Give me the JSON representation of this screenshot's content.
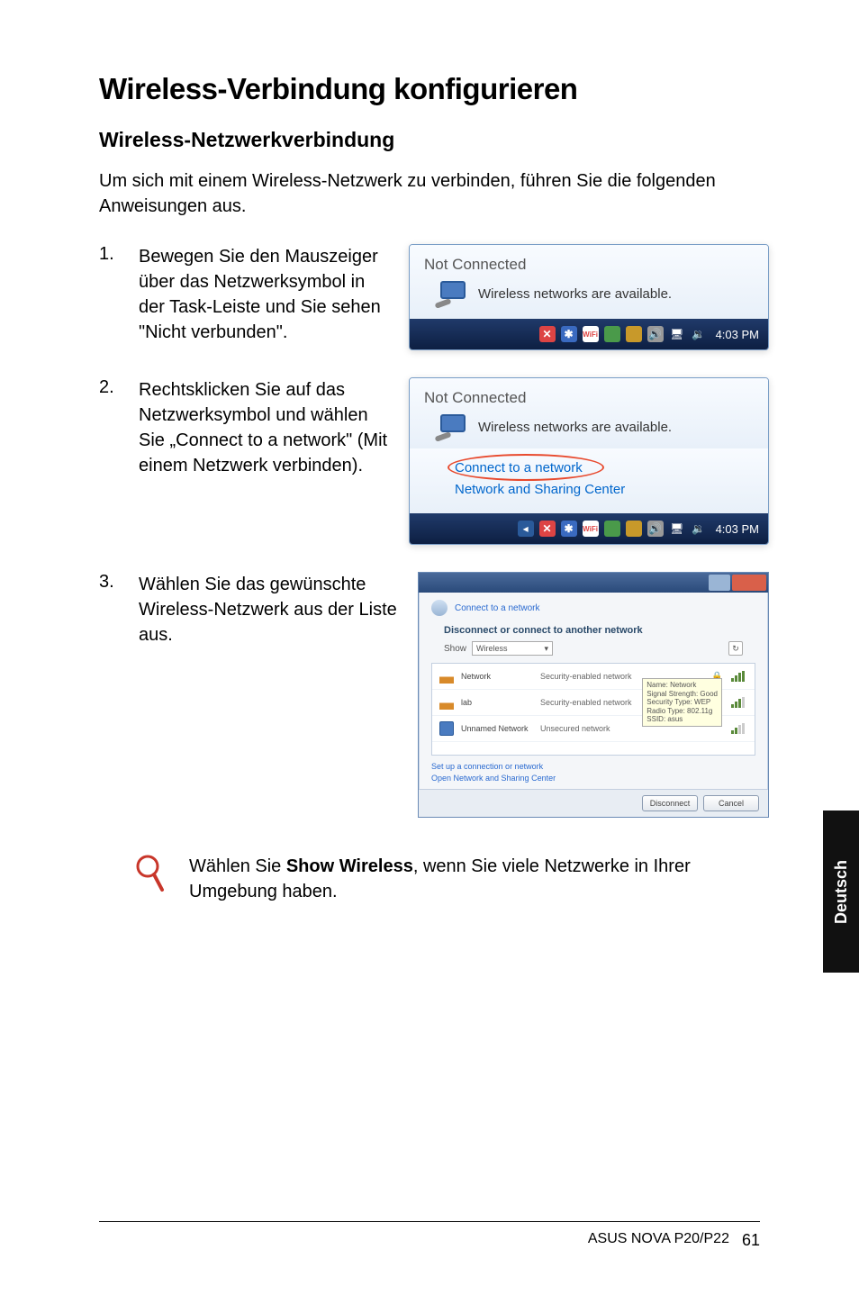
{
  "headings": {
    "h1": "Wireless-Verbindung konfigurieren",
    "h2": "Wireless-Netzwerkverbindung"
  },
  "intro": "Um sich mit einem Wireless-Netzwerk zu verbinden, führen Sie die folgenden Anweisungen aus.",
  "steps": [
    {
      "num": "1.",
      "text": "Bewegen Sie den Mauszeiger über das Netzwerksymbol in der Task-Leiste und Sie sehen \"Nicht verbunden\"."
    },
    {
      "num": "2.",
      "text": "Rechtsklicken Sie auf das Netzwerksymbol und wählen Sie „Connect to a network\" (Mit einem Netzwerk verbinden)."
    },
    {
      "num": "3.",
      "text": "Wählen Sie das gewünschte Wireless-Netzwerk aus der Liste aus."
    }
  ],
  "popup": {
    "title": "Not Connected",
    "msg": "Wireless networks are available.",
    "link_connect": "Connect to a network",
    "link_center": "Network and Sharing Center"
  },
  "taskbar": {
    "time": "4:03 PM"
  },
  "dialog": {
    "breadcrumb": "Connect to a network",
    "subtitle": "Disconnect or connect to another network",
    "show_label": "Show",
    "show_value": "Wireless",
    "rows": [
      {
        "name": "Network",
        "type": "Security-enabled network"
      },
      {
        "name": "lab",
        "type": "Security-enabled network"
      },
      {
        "name": "Unnamed Network",
        "type": "Unsecured network"
      }
    ],
    "tooltip": {
      "l1": "Name: Network",
      "l2": "Signal Strength: Good",
      "l3": "Security Type: WEP",
      "l4": "Radio Type: 802.11g",
      "l5": "SSID: asus"
    },
    "link1": "Set up a connection or network",
    "link2": "Open Network and Sharing Center",
    "btn_connect": "Disconnect",
    "btn_cancel": "Cancel"
  },
  "tip": {
    "pre": "Wählen Sie ",
    "bold": "Show Wireless",
    "post": ", wenn Sie viele Netzwerke in Ihrer Umgebung haben."
  },
  "side_tab": "Deutsch",
  "footer": {
    "product": "ASUS NOVA P20/P22",
    "page": "61"
  }
}
